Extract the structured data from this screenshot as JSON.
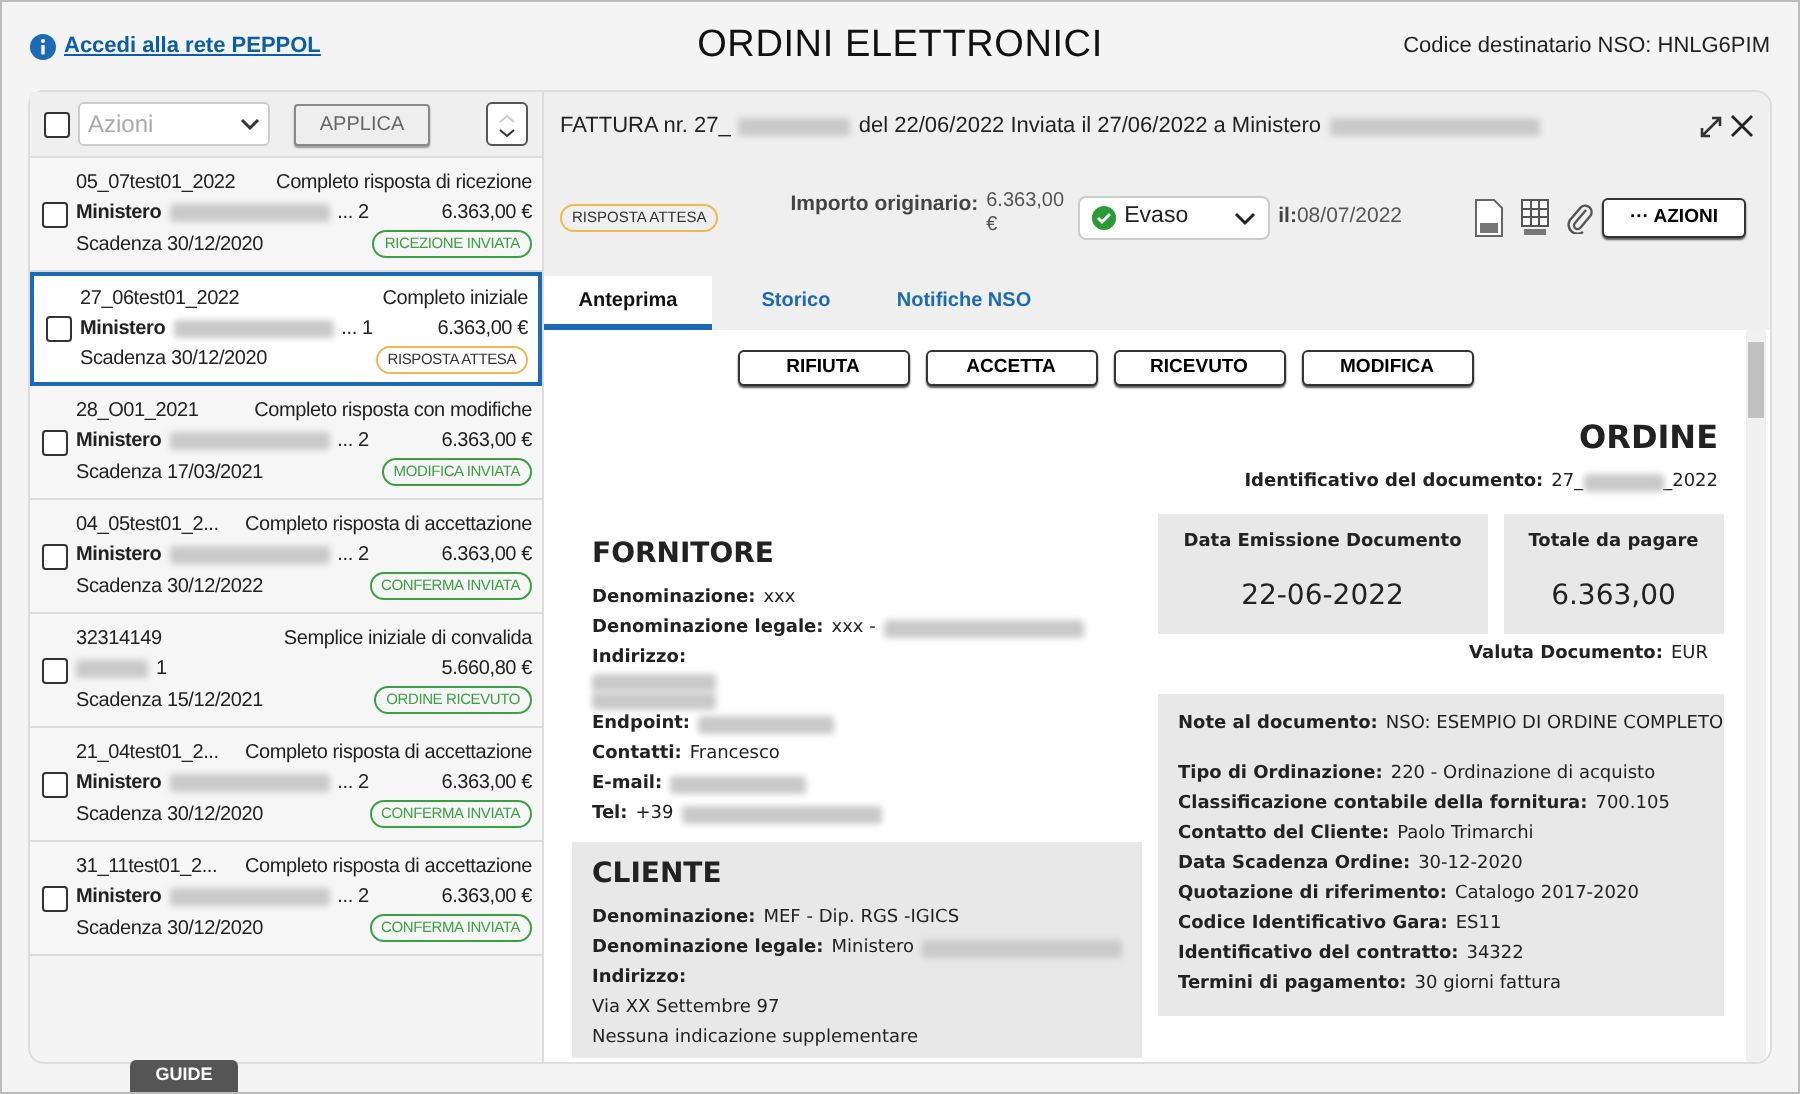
{
  "header": {
    "info_link": "Accedi alla rete PEPPOL",
    "title": "ORDINI ELETTRONICI",
    "recipient_code": "Codice destinatario NSO: HNLG6PIM"
  },
  "list_toolbar": {
    "select_all_checked": false,
    "actions_placeholder": "Azioni",
    "apply_button": "APPLICA"
  },
  "orders": [
    {
      "code": "05_07test01_2022",
      "type": "Completo risposta di ricezione",
      "party": "Ministero",
      "suffix": "... 2",
      "amount": "6.363,00 €",
      "due": "Scadenza 30/12/2020",
      "status": "RICEZIONE INVIATA",
      "color": "#3aa142",
      "checked": false,
      "selected": false
    },
    {
      "code": "27_06test01_2022",
      "type": "Completo iniziale",
      "party": "Ministero",
      "suffix": "... 1",
      "amount": "6.363,00 €",
      "due": "Scadenza 30/12/2020",
      "status": "RISPOSTA ATTESA",
      "color": "#f2b84b",
      "checked": false,
      "selected": true
    },
    {
      "code": "28_O01_2021",
      "type": "Completo risposta con modifiche",
      "party": "Ministero",
      "suffix": "... 2",
      "amount": "6.363,00 €",
      "due": "Scadenza 17/03/2021",
      "status": "MODIFICA INVIATA",
      "color": "#3aa142",
      "checked": false,
      "selected": false
    },
    {
      "code": "04_05test01_2...",
      "type": "Completo risposta di accettazione",
      "party": "Ministero",
      "suffix": "... 2",
      "amount": "6.363,00 €",
      "due": "Scadenza 30/12/2022",
      "status": "CONFERMA INVIATA",
      "color": "#3aa142",
      "checked": false,
      "selected": false
    },
    {
      "code": "32314149",
      "type": "Semplice iniziale di convalida",
      "suffix": "1",
      "amount": "5.660,80 €",
      "due": "Scadenza 15/12/2021",
      "status": "ORDINE RICEVUTO",
      "color": "#3aa142",
      "checked": false,
      "selected": false
    },
    {
      "code": "21_04test01_2...",
      "type": "Completo risposta di accettazione",
      "party": "Ministero",
      "suffix": "... 2",
      "amount": "6.363,00 €",
      "due": "Scadenza 30/12/2020",
      "status": "CONFERMA INVIATA",
      "color": "#3aa142",
      "checked": false,
      "selected": false
    },
    {
      "code": "31_11test01_2...",
      "type": "Completo risposta di accettazione",
      "party": "Ministero",
      "suffix": "... 2",
      "amount": "6.363,00 €",
      "due": "Scadenza 30/12/2020",
      "status": "CONFERMA INVIATA",
      "color": "#3aa142",
      "checked": false,
      "selected": false
    }
  ],
  "detail": {
    "title_start": "FATTURA nr. 27_",
    "title_end": "del 22/06/2022 Inviata il 27/06/2022 a Ministero",
    "status": "RISPOSTA ATTESA",
    "amount_label": "Importo originario:",
    "amount": "6.363,00 €",
    "state": "Evaso",
    "date_label": "il:",
    "date": "08/07/2022",
    "actions_button": "··· AZIONI",
    "tabs": [
      {
        "label": "Anteprima",
        "selected": true
      },
      {
        "label": "Storico",
        "selected": false
      },
      {
        "label": "Notifiche NSO",
        "selected": false
      }
    ],
    "buttons": [
      "RIFIUTA",
      "ACCETTA",
      "RICEVUTO",
      "MODIFICA"
    ],
    "document": {
      "title": "ORDINE",
      "id_label": "Identificativo del documento:",
      "id_start": "27_",
      "id_end": "_2022",
      "issue_label": "Data Emissione Documento",
      "issue_date": "22-06-2022",
      "total_label": "Totale da pagare",
      "total": "6.363,00",
      "currency_label": "Valuta Documento:",
      "currency": "EUR",
      "supplier": {
        "title": "FORNITORE",
        "fields": [
          {
            "kind": "field",
            "label": "Denominazione:",
            "value": "xxx"
          },
          {
            "kind": "field",
            "label": "Denominazione legale:",
            "value": "xxx -",
            "redacted": true
          },
          {
            "kind": "field",
            "label": "Indirizzo:"
          },
          {
            "kind": "redacted"
          },
          {
            "kind": "redacted"
          },
          {
            "kind": "field",
            "label": "Endpoint:",
            "redacted": true
          },
          {
            "kind": "field",
            "label": "Contatti:",
            "value": "Francesco"
          },
          {
            "kind": "field",
            "label": "E-mail:",
            "redacted": true
          },
          {
            "kind": "field",
            "label": "Tel:",
            "value": "+39",
            "redacted": true
          }
        ]
      },
      "customer": {
        "title": "CLIENTE",
        "fields": [
          {
            "kind": "field",
            "label": "Denominazione:",
            "value": "MEF - Dip. RGS -IGICS"
          },
          {
            "kind": "field",
            "label": "Denominazione legale:",
            "value": "Ministero",
            "redacted": true
          },
          {
            "kind": "field",
            "label": "Indirizzo:"
          },
          {
            "kind": "text",
            "value": "Via XX Settembre 97"
          },
          {
            "kind": "text",
            "value": "Nessuna indicazione supplementare"
          }
        ]
      },
      "note": {
        "label": "Note al documento:",
        "value": "NSO: ESEMPIO DI ORDINE COMPLETO"
      },
      "details": [
        {
          "label": "Tipo di Ordinazione:",
          "value": "220 - Ordinazione di acquisto"
        },
        {
          "label": "Classificazione contabile della fornitura:",
          "value": "700.105"
        },
        {
          "label": "Contatto del Cliente:",
          "value": "Paolo Trimarchi"
        },
        {
          "label": "Data Scadenza Ordine:",
          "value": "30-12-2020"
        },
        {
          "label": "Quotazione di riferimento:",
          "value": "Catalogo 2017-2020"
        },
        {
          "label": "Codice Identificativo Gara:",
          "value": "ES11"
        },
        {
          "label": "Identificativo del contratto:",
          "value": "34322"
        },
        {
          "label": "Termini di pagamento:",
          "value": "30 giorni fattura"
        }
      ]
    }
  },
  "guide_tab": "GUIDE"
}
